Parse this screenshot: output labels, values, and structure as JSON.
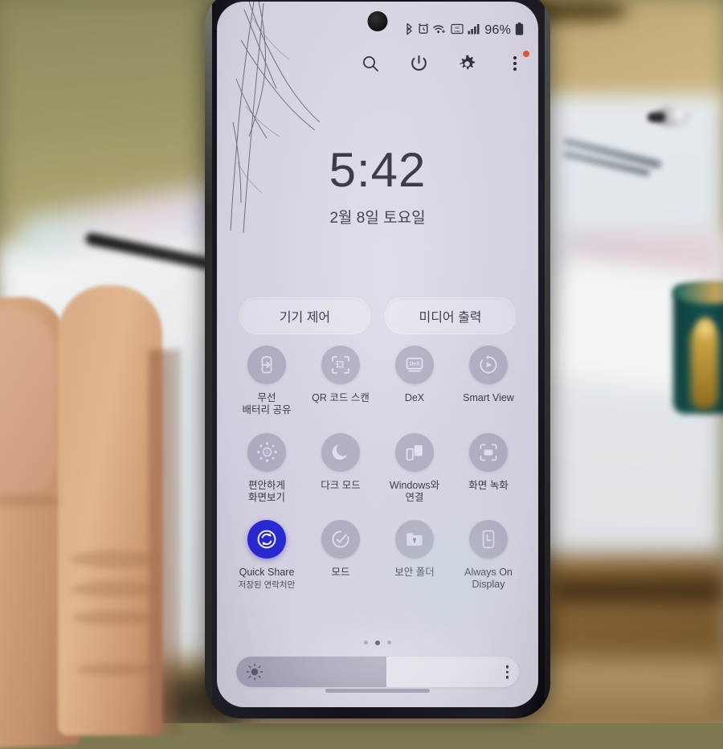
{
  "device": {
    "type": "smartphone",
    "screen_background": "#dfdae9",
    "condition_note": "cracked-screen-upper-left"
  },
  "status_bar": {
    "icons": [
      "bluetooth-icon",
      "alarm-icon",
      "wifi-icon",
      "volte-icon",
      "signal-icon"
    ],
    "battery_percent": "96%",
    "battery_icon": "battery-icon"
  },
  "quick_panel_header": {
    "buttons": [
      {
        "name": "search-button",
        "icon": "search-icon"
      },
      {
        "name": "power-button",
        "icon": "power-icon"
      },
      {
        "name": "settings-button",
        "icon": "gear-icon"
      },
      {
        "name": "more-options-button",
        "icon": "three-dots-icon",
        "badge": true
      }
    ],
    "badge_color": "#e8562d"
  },
  "lockscreen": {
    "time": "5:42",
    "date": "2월 8일 토요일"
  },
  "pills": [
    {
      "label": "기기 제어",
      "name": "device-control-button"
    },
    {
      "label": "미디어 출력",
      "name": "media-output-button"
    }
  ],
  "toggles": [
    [
      {
        "label": "무선\n배터리 공유",
        "line1": "무선",
        "line2": "배터리 공유",
        "icon": "wireless-powershare-icon",
        "active": false
      },
      {
        "label": "QR 코드 스캔",
        "line1": "QR 코드 스캔",
        "line2": "",
        "icon": "qr-scan-icon",
        "active": false
      },
      {
        "label": "DeX",
        "line1": "DeX",
        "line2": "",
        "icon": "dex-icon",
        "active": false
      },
      {
        "label": "Smart View",
        "line1": "Smart View",
        "line2": "",
        "icon": "smart-view-icon",
        "active": false
      }
    ],
    [
      {
        "label": "편안하게\n화면보기",
        "line1": "편안하게",
        "line2": "화면보기",
        "icon": "eye-comfort-shield-icon",
        "active": false
      },
      {
        "label": "다크 모드",
        "line1": "다크 모드",
        "line2": "",
        "icon": "dark-mode-icon",
        "active": false
      },
      {
        "label": "Windows와\n연결",
        "line1": "Windows와",
        "line2": "연결",
        "icon": "link-to-windows-icon",
        "active": false
      },
      {
        "label": "화면 녹화",
        "line1": "화면 녹화",
        "line2": "",
        "icon": "screen-recorder-icon",
        "active": false
      }
    ],
    [
      {
        "label": "Quick Share",
        "line1": "Quick Share",
        "line2": "",
        "sublabel": "저장된 연락처만",
        "icon": "quick-share-icon",
        "active": true,
        "active_color": "#1f1fd6"
      },
      {
        "label": "모드",
        "line1": "모드",
        "line2": "",
        "icon": "modes-icon",
        "active": false
      },
      {
        "label": "보안 폴더",
        "line1": "보안 폴더",
        "line2": "",
        "icon": "secure-folder-icon",
        "active": false
      },
      {
        "label": "Always On\nDisplay",
        "line1": "Always On",
        "line2": "Display",
        "icon": "always-on-display-icon",
        "active": false
      }
    ]
  ],
  "page_indicator": {
    "total": 3,
    "active_index": 1
  },
  "brightness": {
    "value_percent": 53,
    "icon": "brightness-icon",
    "menu_icon": "three-dots-icon"
  },
  "navigation": {
    "gesture_bar": true
  }
}
